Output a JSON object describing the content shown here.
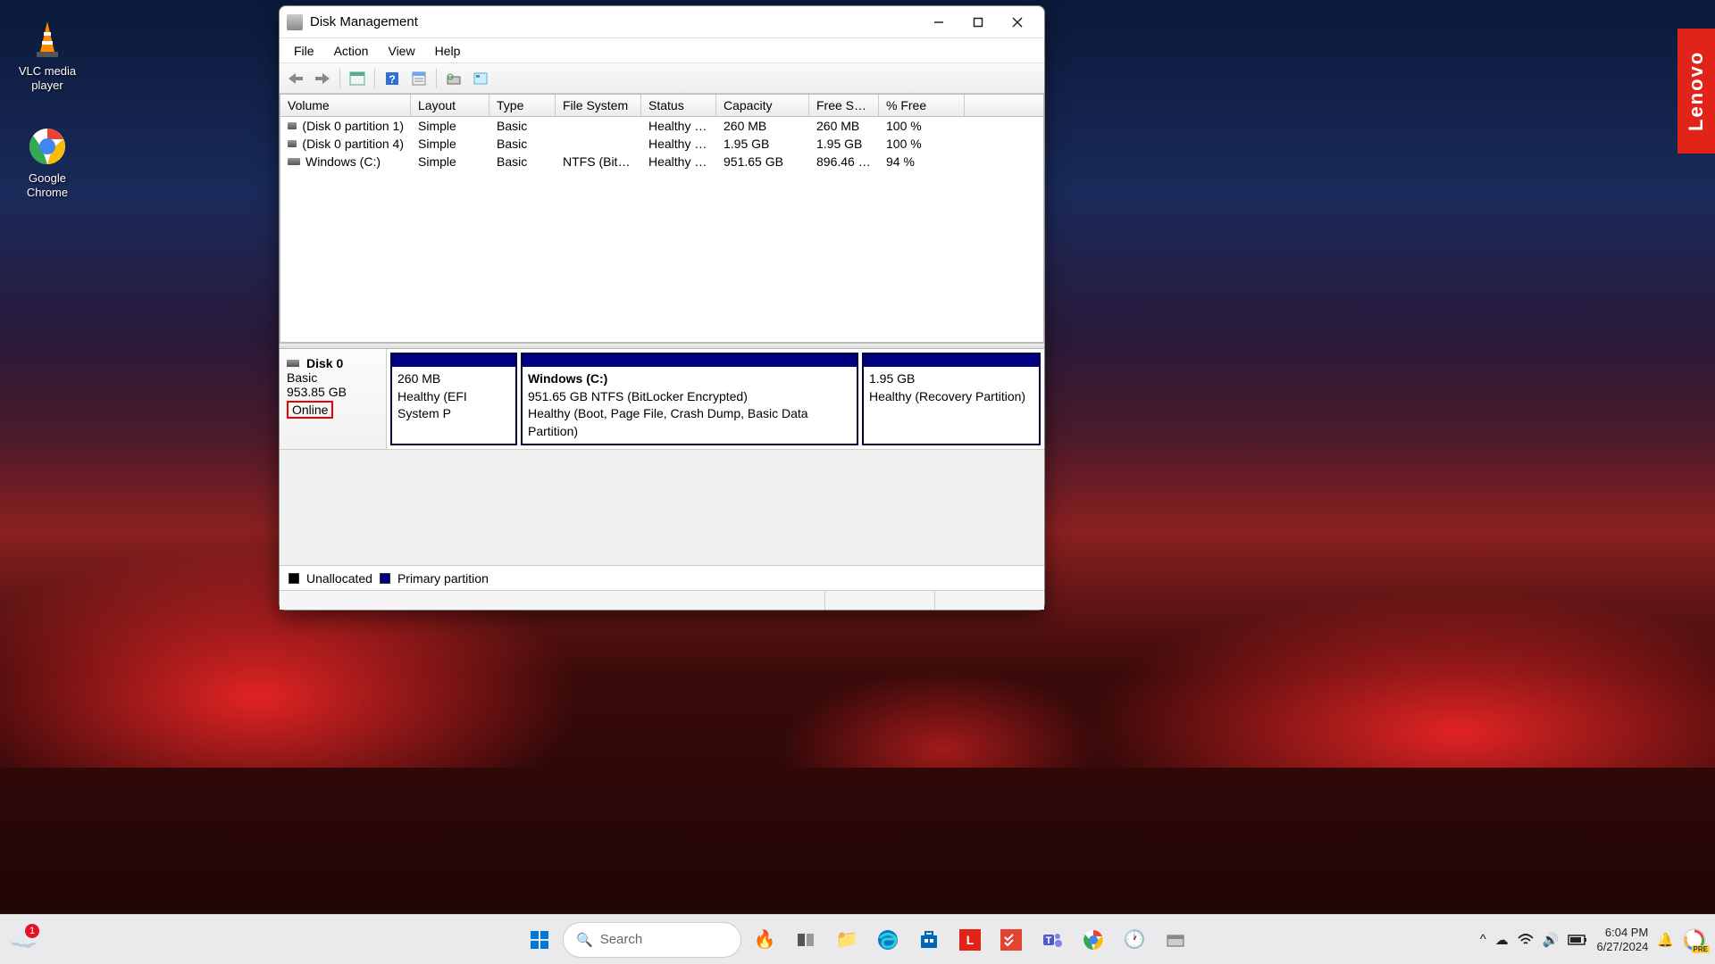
{
  "desktop_icons": {
    "vlc": {
      "label": "VLC media player"
    },
    "chrome": {
      "label": "Google Chrome"
    }
  },
  "lenovo_tab": "Lenovo",
  "window": {
    "title": "Disk Management",
    "menu": {
      "file": "File",
      "action": "Action",
      "view": "View",
      "help": "Help"
    },
    "toolbar_names": {
      "back": "back",
      "forward": "forward",
      "up": "up",
      "help": "help",
      "properties": "properties",
      "refresh": "refresh",
      "connect": "connect"
    }
  },
  "columns": {
    "volume": "Volume",
    "layout": "Layout",
    "type": "Type",
    "fs": "File System",
    "status": "Status",
    "capacity": "Capacity",
    "free": "Free Sp...",
    "pct": "% Free"
  },
  "volumes": [
    {
      "name": "(Disk 0 partition 1)",
      "layout": "Simple",
      "type": "Basic",
      "fs": "",
      "status": "Healthy (E...",
      "capacity": "260 MB",
      "free": "260 MB",
      "pct": "100 %"
    },
    {
      "name": "(Disk 0 partition 4)",
      "layout": "Simple",
      "type": "Basic",
      "fs": "",
      "status": "Healthy (R...",
      "capacity": "1.95 GB",
      "free": "1.95 GB",
      "pct": "100 %"
    },
    {
      "name": "Windows (C:)",
      "layout": "Simple",
      "type": "Basic",
      "fs": "NTFS (BitLo...",
      "status": "Healthy (B...",
      "capacity": "951.65 GB",
      "free": "896.46 GB",
      "pct": "94 %"
    }
  ],
  "disk": {
    "name": "Disk 0",
    "type": "Basic",
    "size": "953.85 GB",
    "status": "Online"
  },
  "partitions": [
    {
      "name": "",
      "size": "260 MB",
      "status": "Healthy (EFI System P"
    },
    {
      "name": "Windows  (C:)",
      "size": "951.65 GB NTFS (BitLocker Encrypted)",
      "status": "Healthy (Boot, Page File, Crash Dump, Basic Data Partition)"
    },
    {
      "name": "",
      "size": "1.95 GB",
      "status": "Healthy (Recovery Partition)"
    }
  ],
  "legend": {
    "unallocated": "Unallocated",
    "primary": "Primary partition"
  },
  "taskbar": {
    "search_placeholder": "Search",
    "weather_badge": "1",
    "time": "6:04 PM",
    "date": "6/27/2024",
    "pre_label": "PRE"
  }
}
